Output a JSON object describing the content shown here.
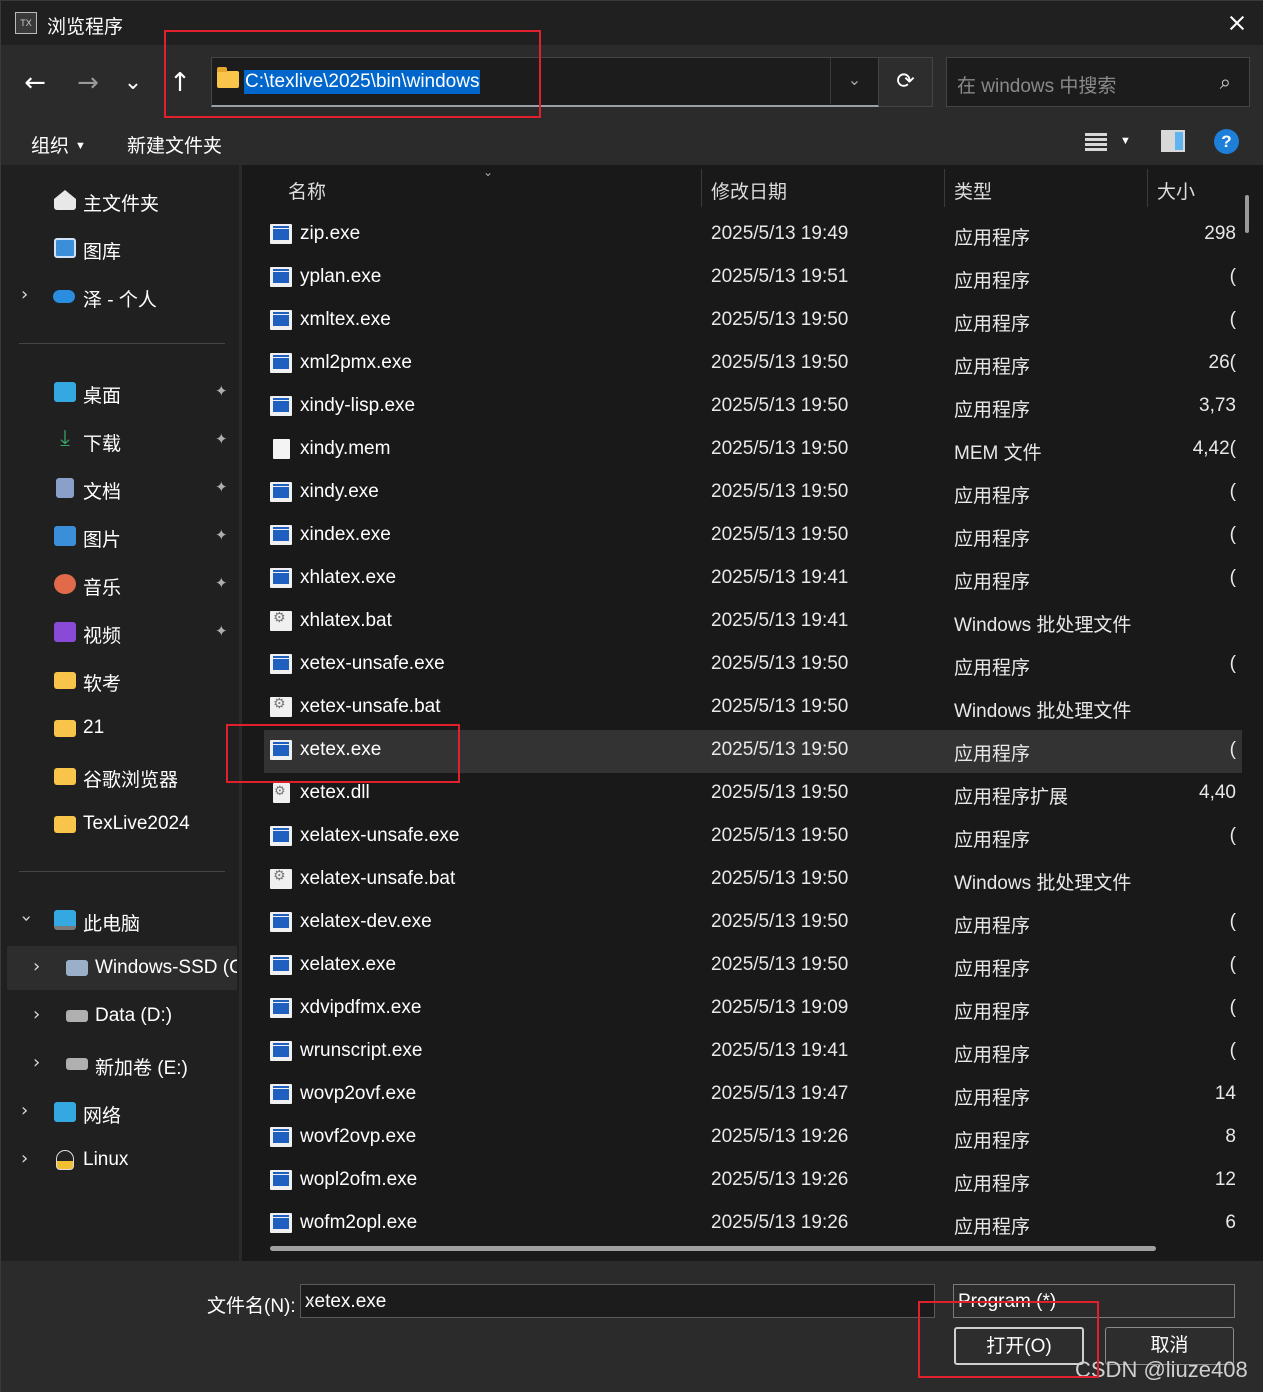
{
  "window": {
    "title": "浏览程序",
    "app_icon": "texlive-icon"
  },
  "nav": {
    "back_icon": "←",
    "forward_icon": "→",
    "recent_icon": "⌄",
    "up_icon": "↑",
    "address": "C:\\texlive\\2025\\bin\\windows",
    "refresh_icon": "⟳",
    "search_placeholder": "在 windows 中搜索",
    "search_icon": "⌕"
  },
  "commands": {
    "organize": "组织",
    "new_folder": "新建文件夹",
    "help": "?"
  },
  "sidebar": {
    "quick": [
      {
        "label": "主文件夹",
        "icon": "home-icon",
        "color": "#e8e8e8"
      },
      {
        "label": "图库",
        "icon": "gallery-icon",
        "color": "#3a8fd8"
      },
      {
        "label": "泽 - 个人",
        "icon": "onedrive-icon",
        "color": "#2b8de0",
        "expandable": true
      }
    ],
    "pinned": [
      {
        "label": "桌面",
        "icon": "desktop-icon",
        "color": "#34a8e0"
      },
      {
        "label": "下载",
        "icon": "download-icon",
        "color": "#3aa46a"
      },
      {
        "label": "文档",
        "icon": "documents-icon",
        "color": "#8aa0c8"
      },
      {
        "label": "图片",
        "icon": "pictures-icon",
        "color": "#3a8fd8"
      },
      {
        "label": "音乐",
        "icon": "music-icon",
        "color": "#e06a4a"
      },
      {
        "label": "视频",
        "icon": "videos-icon",
        "color": "#8a4ad8"
      },
      {
        "label": "软考",
        "icon": "folder-icon",
        "color": "#f8c44a"
      },
      {
        "label": "21",
        "icon": "folder-icon",
        "color": "#f8c44a"
      },
      {
        "label": "谷歌浏览器",
        "icon": "folder-icon",
        "color": "#f8c44a"
      },
      {
        "label": "TexLive2024",
        "icon": "folder-icon",
        "color": "#f8c44a"
      }
    ],
    "pin_icon": "📌",
    "this_pc": {
      "label": "此电脑",
      "icon": "computer-icon"
    },
    "drives": [
      {
        "label": "Windows-SSD (C",
        "icon": "drive-windows-icon",
        "selected": true
      },
      {
        "label": "Data (D:)",
        "icon": "drive-icon"
      },
      {
        "label": "新加卷 (E:)",
        "icon": "drive-icon"
      }
    ],
    "network": {
      "label": "网络",
      "icon": "network-icon"
    },
    "linux": {
      "label": "Linux",
      "icon": "linux-penguin-icon"
    }
  },
  "columns": {
    "name": "名称",
    "date": "修改日期",
    "type": "类型",
    "size": "大小"
  },
  "files": [
    {
      "name": "zip.exe",
      "date": "2025/5/13 19:49",
      "type": "应用程序",
      "size": "298",
      "icon": "exe"
    },
    {
      "name": "yplan.exe",
      "date": "2025/5/13 19:51",
      "type": "应用程序",
      "size": "(",
      "icon": "exe"
    },
    {
      "name": "xmltex.exe",
      "date": "2025/5/13 19:50",
      "type": "应用程序",
      "size": "(",
      "icon": "exe"
    },
    {
      "name": "xml2pmx.exe",
      "date": "2025/5/13 19:50",
      "type": "应用程序",
      "size": "26(",
      "icon": "exe"
    },
    {
      "name": "xindy-lisp.exe",
      "date": "2025/5/13 19:50",
      "type": "应用程序",
      "size": "3,73",
      "icon": "exe"
    },
    {
      "name": "xindy.mem",
      "date": "2025/5/13 19:50",
      "type": "MEM 文件",
      "size": "4,42(",
      "icon": "doc"
    },
    {
      "name": "xindy.exe",
      "date": "2025/5/13 19:50",
      "type": "应用程序",
      "size": "(",
      "icon": "exe"
    },
    {
      "name": "xindex.exe",
      "date": "2025/5/13 19:50",
      "type": "应用程序",
      "size": "(",
      "icon": "exe"
    },
    {
      "name": "xhlatex.exe",
      "date": "2025/5/13 19:41",
      "type": "应用程序",
      "size": "(",
      "icon": "exe"
    },
    {
      "name": "xhlatex.bat",
      "date": "2025/5/13 19:41",
      "type": "Windows 批处理文件",
      "size": "",
      "icon": "bat"
    },
    {
      "name": "xetex-unsafe.exe",
      "date": "2025/5/13 19:50",
      "type": "应用程序",
      "size": "(",
      "icon": "exe"
    },
    {
      "name": "xetex-unsafe.bat",
      "date": "2025/5/13 19:50",
      "type": "Windows 批处理文件",
      "size": "",
      "icon": "bat"
    },
    {
      "name": "xetex.exe",
      "date": "2025/5/13 19:50",
      "type": "应用程序",
      "size": "(",
      "icon": "exe",
      "selected": true
    },
    {
      "name": "xetex.dll",
      "date": "2025/5/13 19:50",
      "type": "应用程序扩展",
      "size": "4,40",
      "icon": "dll"
    },
    {
      "name": "xelatex-unsafe.exe",
      "date": "2025/5/13 19:50",
      "type": "应用程序",
      "size": "(",
      "icon": "exe"
    },
    {
      "name": "xelatex-unsafe.bat",
      "date": "2025/5/13 19:50",
      "type": "Windows 批处理文件",
      "size": "",
      "icon": "bat"
    },
    {
      "name": "xelatex-dev.exe",
      "date": "2025/5/13 19:50",
      "type": "应用程序",
      "size": "(",
      "icon": "exe"
    },
    {
      "name": "xelatex.exe",
      "date": "2025/5/13 19:50",
      "type": "应用程序",
      "size": "(",
      "icon": "exe"
    },
    {
      "name": "xdvipdfmx.exe",
      "date": "2025/5/13 19:09",
      "type": "应用程序",
      "size": "(",
      "icon": "exe"
    },
    {
      "name": "wrunscript.exe",
      "date": "2025/5/13 19:41",
      "type": "应用程序",
      "size": "(",
      "icon": "exe"
    },
    {
      "name": "wovp2ovf.exe",
      "date": "2025/5/13 19:47",
      "type": "应用程序",
      "size": "14",
      "icon": "exe"
    },
    {
      "name": "wovf2ovp.exe",
      "date": "2025/5/13 19:26",
      "type": "应用程序",
      "size": "8",
      "icon": "exe"
    },
    {
      "name": "wopl2ofm.exe",
      "date": "2025/5/13 19:26",
      "type": "应用程序",
      "size": "12",
      "icon": "exe"
    },
    {
      "name": "wofm2opl.exe",
      "date": "2025/5/13 19:26",
      "type": "应用程序",
      "size": "6",
      "icon": "exe"
    }
  ],
  "footer": {
    "filename_label": "文件名(N):",
    "filename_value": "xetex.exe",
    "filter_value": "Program (*)",
    "open_label": "打开(O)",
    "cancel_label": "取消",
    "watermark": "CSDN @liuze408"
  }
}
